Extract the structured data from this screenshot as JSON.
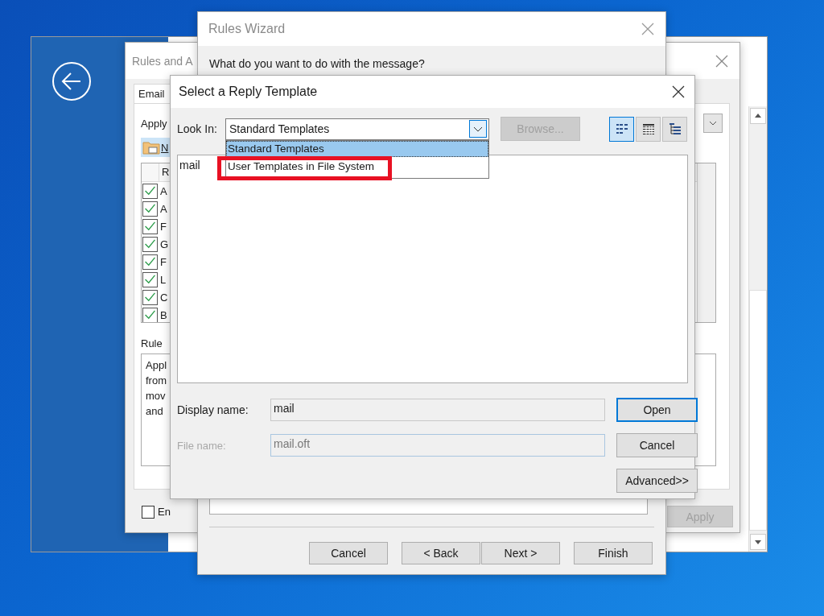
{
  "rules_and_alerts": {
    "title": "Rules and A",
    "tab": "Email",
    "apply_label": "Apply",
    "new_rule_button": "N",
    "list_header": "R",
    "rules": [
      {
        "name": "A",
        "checked": true
      },
      {
        "name": "A",
        "checked": true
      },
      {
        "name": "F",
        "checked": true
      },
      {
        "name": "G",
        "checked": true
      },
      {
        "name": "F",
        "checked": true
      },
      {
        "name": "L",
        "checked": true
      },
      {
        "name": "C",
        "checked": true
      },
      {
        "name": "B",
        "checked": true
      }
    ],
    "description_label": "Rule",
    "description_lines": [
      "Appl",
      "from",
      "mov",
      "and"
    ],
    "enable_checkbox": {
      "label": "En",
      "checked": false
    },
    "apply_button": {
      "label": "Apply",
      "disabled": true
    }
  },
  "rules_wizard": {
    "title": "Rules Wizard",
    "prompt": "What do you want to do with the message?",
    "buttons": [
      {
        "label": "Cancel"
      },
      {
        "label": "< Back"
      },
      {
        "label": "Next >"
      },
      {
        "label": "Finish"
      }
    ]
  },
  "template_dialog": {
    "title": "Select a Reply Template",
    "look_in_label": "Look In:",
    "look_in_value": "Standard Templates",
    "look_in_options": [
      {
        "label": "Standard Templates",
        "selected": true,
        "highlighted": false
      },
      {
        "label": "User Templates in File System",
        "selected": false,
        "highlighted": true
      }
    ],
    "browse_button": {
      "label": "Browse...",
      "disabled": true
    },
    "view_buttons": [
      {
        "kind": "list",
        "selected": true
      },
      {
        "kind": "details",
        "selected": false
      },
      {
        "kind": "tree",
        "selected": false
      }
    ],
    "files": [
      {
        "name": "mail"
      }
    ],
    "display_name": {
      "label": "Display name:",
      "value": "mail",
      "disabled": false
    },
    "file_name": {
      "label": "File name:",
      "value": "mail.oft",
      "disabled": true
    },
    "buttons": [
      {
        "label": "Open",
        "default": true
      },
      {
        "label": "Cancel",
        "default": false
      },
      {
        "label": "Advanced>>",
        "default": false
      }
    ]
  }
}
